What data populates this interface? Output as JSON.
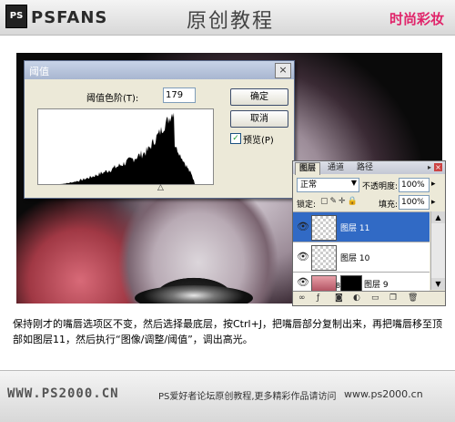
{
  "header": {
    "logo_mark": "PS",
    "logo_text": "PSFANS",
    "title": "原创教程",
    "right_text": "时尚彩妆",
    "accent_color": "#e0246a"
  },
  "threshold_dialog": {
    "title": "阈值",
    "level_label": "阈值色阶(T):",
    "level_value": "179",
    "ok_label": "确定",
    "cancel_label": "取消",
    "preview_checked": true,
    "preview_label": "预览(P)",
    "close_icon": "×"
  },
  "layers_panel": {
    "tabs": [
      "图层",
      "通道",
      "路径"
    ],
    "blend_mode": "正常",
    "opacity_label": "不透明度:",
    "opacity_value": "100%",
    "lock_label": "锁定:",
    "fill_label": "填充:",
    "fill_value": "100%",
    "layers": [
      {
        "name": "图层 11",
        "selected": true
      },
      {
        "name": "图层 10",
        "selected": false
      },
      {
        "name": "图层 9",
        "selected": false
      }
    ]
  },
  "description": "保持刚才的嘴唇选项区不变，然后选择最底层，按Ctrl+J，把嘴唇部分复制出来，再把嘴唇移至顶部如图层11，然后执行“图像/调整/阈值”，调出高光。",
  "footer": {
    "left": "WWW.PS2000.CN",
    "middle": "PS爱好者论坛原创教程,更多精彩作品请访问",
    "right": "www.ps2000.cn"
  }
}
